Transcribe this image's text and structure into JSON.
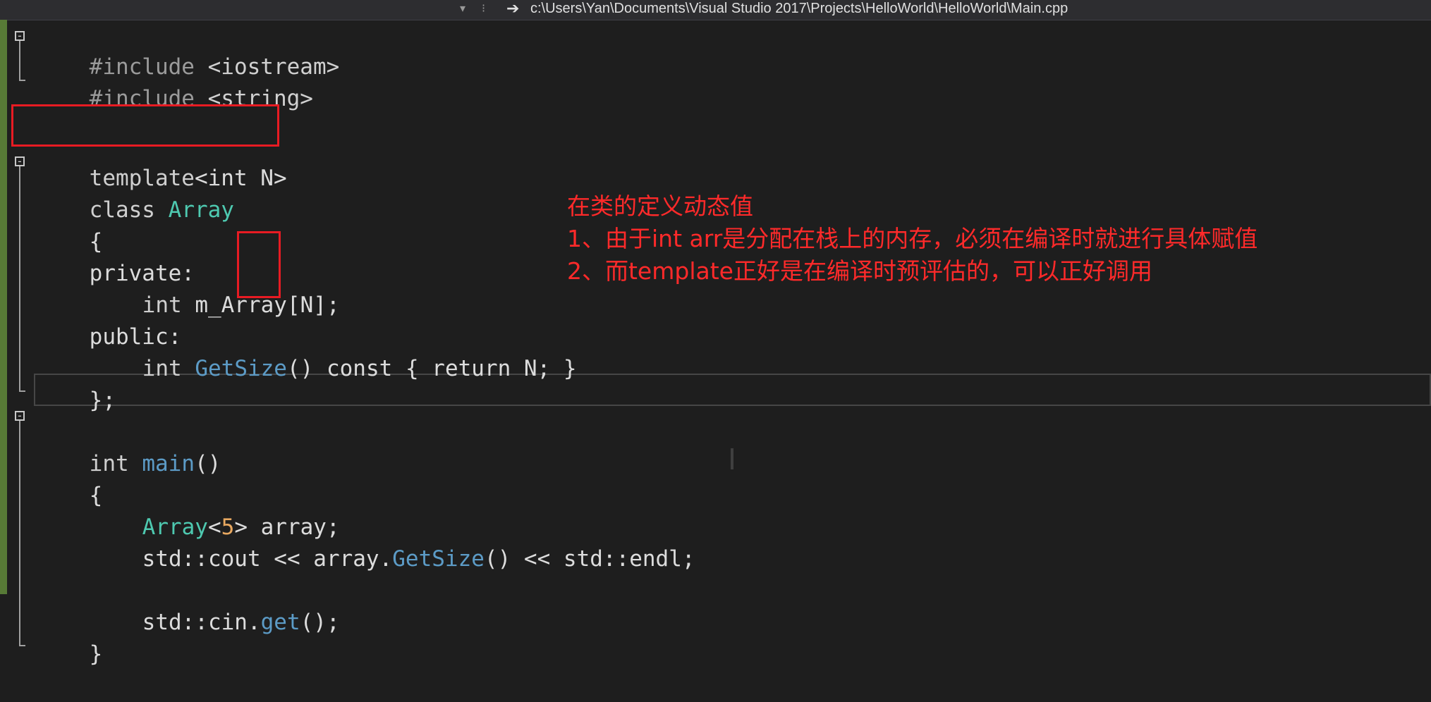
{
  "toolbar": {
    "scroll_down_glyph": "▾",
    "split_glyph": "⁝",
    "nav_icon": "arrow-right-icon",
    "file_path": "c:\\Users\\Yan\\Documents\\Visual Studio 2017\\Projects\\HelloWorld\\HelloWorld\\Main.cpp"
  },
  "code": {
    "lines": [
      {
        "pre": "#include",
        "rest": " <iostream>"
      },
      {
        "pre": "#include",
        "rest": " <string>"
      },
      {
        "text": ""
      },
      {
        "kw": "template",
        "rest": "<int N>"
      },
      {
        "kw": "class",
        "type": "Array"
      },
      {
        "text": "{"
      },
      {
        "text": "private:"
      },
      {
        "kw": "int",
        "rest": " m_Array[N];"
      },
      {
        "text": "public:"
      },
      {
        "kw": "int",
        "fn": "GetSize",
        "rest": "() const { return N; }"
      },
      {
        "text": "};"
      },
      {
        "text": ""
      },
      {
        "kw": "int",
        "fn": "main",
        "rest": "()"
      },
      {
        "text": "{"
      },
      {
        "type": "Array",
        "lt": "<",
        "num": "5",
        "rest": "> array;"
      },
      {
        "pre_std": "std::cout << array.",
        "fn": "GetSize",
        "rest": "() << std::endl;"
      },
      {
        "text": ""
      },
      {
        "pre_std": "std::cin.",
        "fn": "get",
        "rest": "();"
      },
      {
        "text": "}"
      }
    ]
  },
  "annotation": {
    "title": "在类的定义动态值",
    "point1": "1、由于int arr是分配在栈上的内存，必须在编译时就进行具体赋值",
    "point2": "2、而template正好是在编译时预评估的，可以正好调用"
  },
  "colors": {
    "background": "#1e1e1e",
    "annotation_red": "#ff2a2a",
    "highlight_box": "#e81b23",
    "type_teal": "#4ec9b0",
    "function_blue": "#5c9bc6",
    "number_orange": "#e8a860",
    "change_bar": "#577a36"
  }
}
